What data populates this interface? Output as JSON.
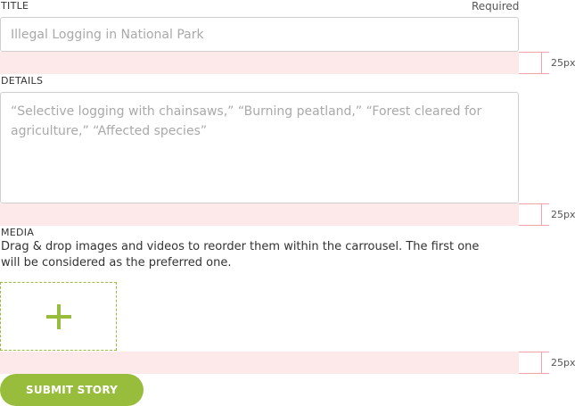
{
  "form": {
    "title": {
      "label": "TITLE",
      "required_note": "Required",
      "placeholder": "Illegal Logging in National Park",
      "value": ""
    },
    "details": {
      "label": "DETAILS",
      "placeholder": "“Selective logging with chainsaws,” “Burning peatland,” “Forest cleared for agriculture,” “Affected species”",
      "value": ""
    },
    "media": {
      "label": "MEDIA",
      "description": "Drag & drop images and videos to reorder them within the carrousel. The first one will be considered as the preferred one.",
      "add_icon": "plus-icon"
    },
    "submit_label": "SUBMIT STORY"
  },
  "spacing_annotations": [
    {
      "label": "25px"
    },
    {
      "label": "25px"
    },
    {
      "label": "25px"
    }
  ],
  "colors": {
    "accent": "#98bd3d",
    "spacing_band": "#fde9ea",
    "measure_line": "#f2a3a8",
    "input_border": "#cfcfcf"
  }
}
